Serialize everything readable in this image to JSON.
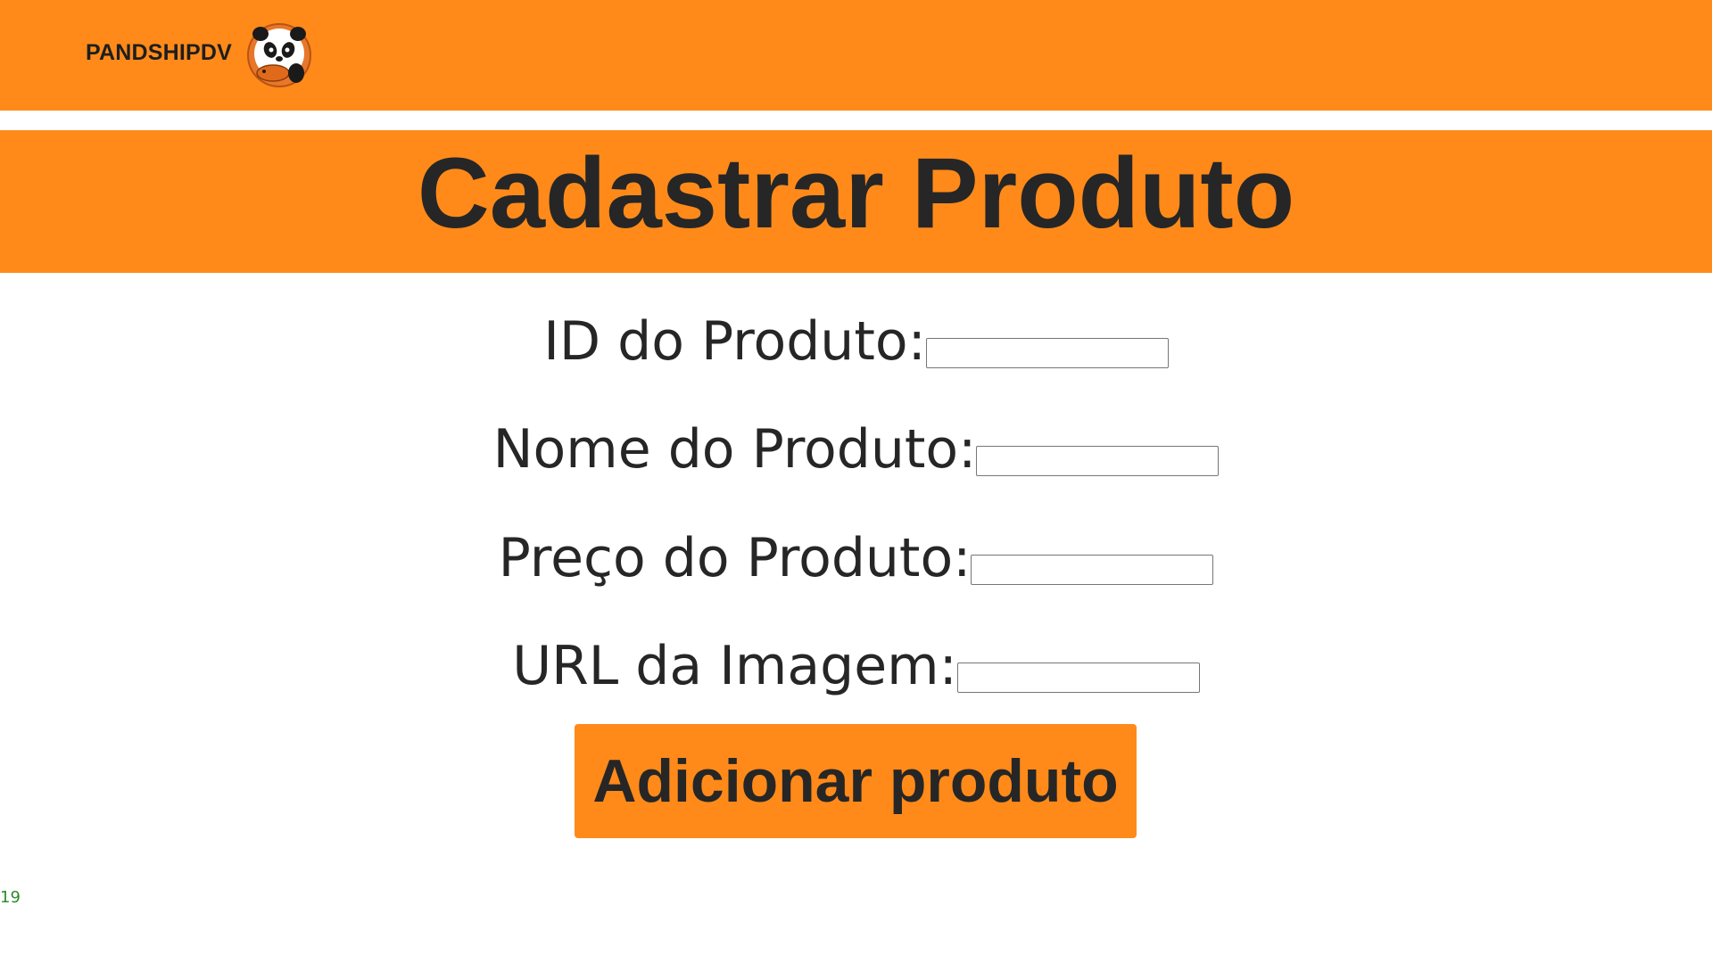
{
  "header": {
    "brand": "PANDSHIPDV",
    "logo_icon": "panda-logo-icon",
    "background_color": "#ff8a1a"
  },
  "page": {
    "title": "Cadastrar Produto"
  },
  "form": {
    "fields": [
      {
        "label": "ID do Produto:",
        "value": "",
        "placeholder": ""
      },
      {
        "label": "Nome do Produto:",
        "value": "",
        "placeholder": ""
      },
      {
        "label": "Preço do Produto:",
        "value": "",
        "placeholder": ""
      },
      {
        "label": "URL da Imagem:",
        "value": "",
        "placeholder": ""
      }
    ],
    "submit_label": "Adicionar produto"
  },
  "footer": {
    "stray_text": "19"
  }
}
